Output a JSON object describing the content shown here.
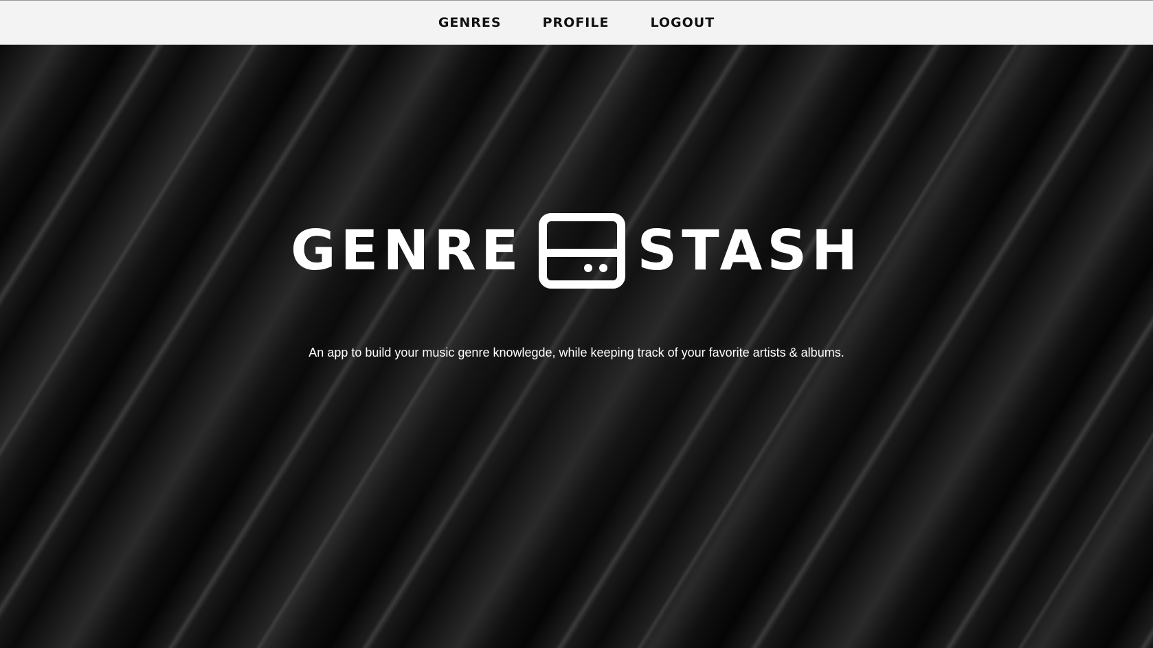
{
  "nav": {
    "items": [
      {
        "label": "GENRES"
      },
      {
        "label": "PROFILE"
      },
      {
        "label": "LOGOUT"
      }
    ]
  },
  "hero": {
    "logo_left": "GENRE",
    "logo_icon": "hard-drive-icon",
    "logo_right": "STASH",
    "tagline": "An app to build your music genre knowlegde, while keeping track of your favorite artists & albums."
  },
  "colors": {
    "navbar_bg": "#f3f3f3",
    "nav_text": "#111111",
    "hero_text": "#ffffff"
  }
}
